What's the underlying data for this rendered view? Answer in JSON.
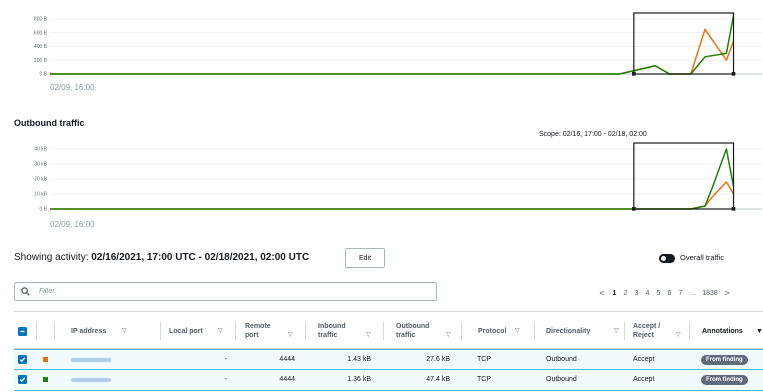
{
  "inbound_chart": {
    "y_ticks": [
      "800 B",
      "600 B",
      "400 B",
      "200 B",
      "0 B"
    ],
    "x_start_label": "02/09, 16:00"
  },
  "outbound_section": {
    "title": "Outbound traffic",
    "scope_label": "Scope:",
    "scope_range": "02/16, 17:00 - 02/18, 02:00"
  },
  "outbound_chart": {
    "y_ticks": [
      "40 kB",
      "30 kB",
      "20 kB",
      "10 kB",
      "0 B"
    ],
    "x_start_label": "02/09, 16:00"
  },
  "colors": {
    "series_orange": "#ec7211",
    "series_green": "#1d8102",
    "selection_blue": "#0073bb",
    "badge_gray": "#5f6b7a"
  },
  "chart_data": [
    {
      "type": "line",
      "y_unit": "B",
      "ylim": [
        0,
        800
      ],
      "y_ticks": [
        0,
        200,
        400,
        600,
        800
      ],
      "x_start": "02/09, 16:00",
      "x": [
        0,
        80,
        85,
        87,
        90,
        92,
        95,
        96
      ],
      "series": [
        {
          "color": "#ec7211",
          "values": [
            0,
            0,
            120,
            0,
            0,
            650,
            200,
            480
          ]
        },
        {
          "color": "#1d8102",
          "values": [
            0,
            0,
            120,
            0,
            0,
            250,
            300,
            850
          ]
        }
      ],
      "selection_x": [
        82,
        96
      ]
    },
    {
      "type": "line",
      "y_unit": "kB",
      "ylim": [
        0,
        40
      ],
      "y_ticks": [
        0,
        10,
        20,
        30,
        40
      ],
      "x_start": "02/09, 16:00",
      "x": [
        0,
        80,
        85,
        87,
        90,
        92,
        93,
        95,
        96
      ],
      "series": [
        {
          "color": "#ec7211",
          "values": [
            0,
            0,
            0,
            0,
            0,
            2,
            8,
            18,
            10
          ]
        },
        {
          "color": "#1d8102",
          "values": [
            0,
            0,
            0,
            0,
            0,
            2,
            14,
            40,
            15
          ]
        }
      ],
      "selection_x": [
        82,
        96
      ]
    }
  ],
  "activity": {
    "prefix": "Showing activity:",
    "range": "02/16/2021, 17:00 UTC - 02/18/2021, 02:00 UTC",
    "edit_label": "Edit",
    "toggle_label": "Overall traffic"
  },
  "filter": {
    "placeholder": "Filter"
  },
  "pagination": {
    "prev": "<",
    "pages": [
      "1",
      "2",
      "3",
      "4",
      "5",
      "6",
      "7"
    ],
    "current": "1",
    "ellipsis": "...",
    "last": "1838",
    "next": ">"
  },
  "table": {
    "columns": {
      "ip": "IP address",
      "local_port": "Local port",
      "remote_port": "Remote port",
      "inbound": "Inbound traffic",
      "outbound": "Outbound traffic",
      "protocol": "Protocol",
      "direction": "Directionality",
      "accept": "Accept / Reject",
      "annotations": "Annotations"
    },
    "rows": [
      {
        "color": "#ec7211",
        "local_port": "-",
        "remote_port": "4444",
        "inbound": "1.43 kB",
        "outbound": "27.6 kB",
        "protocol": "TCP",
        "direction": "Outbound",
        "accept": "Accept",
        "annotation": "From finding"
      },
      {
        "color": "#1d8102",
        "local_port": "-",
        "remote_port": "4444",
        "inbound": "1.36 kB",
        "outbound": "47.4 kB",
        "protocol": "TCP",
        "direction": "Outbound",
        "accept": "Accept",
        "annotation": "From finding"
      }
    ]
  }
}
